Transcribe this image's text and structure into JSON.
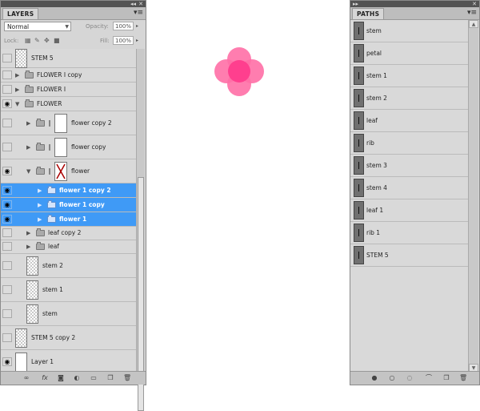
{
  "layers_panel": {
    "tab": "LAYERS",
    "blend_mode": "Normal",
    "opacity_label": "Opacity:",
    "opacity_value": "100%",
    "lock_label": "Lock:",
    "fill_label": "Fill:",
    "fill_value": "100%",
    "rows": [
      {
        "name": "STEM 5",
        "visible": false,
        "type": "pixel-checker",
        "indent": 0
      },
      {
        "name": "FLOWER I copy",
        "visible": false,
        "type": "group",
        "expanded": false,
        "indent": 0
      },
      {
        "name": "FLOWER I",
        "visible": false,
        "type": "group",
        "expanded": false,
        "indent": 0
      },
      {
        "name": "FLOWER",
        "visible": true,
        "type": "group",
        "expanded": true,
        "indent": 0
      },
      {
        "name": "flower copy 2",
        "visible": false,
        "type": "group-masked",
        "expanded": false,
        "indent": 1
      },
      {
        "name": "flower copy",
        "visible": false,
        "type": "group-masked",
        "expanded": false,
        "indent": 1
      },
      {
        "name": "flower",
        "visible": true,
        "type": "group-masked-x",
        "expanded": true,
        "indent": 1
      },
      {
        "name": "flower 1 copy 2",
        "visible": true,
        "type": "group",
        "expanded": false,
        "indent": 2,
        "selected": true
      },
      {
        "name": "flower 1 copy",
        "visible": true,
        "type": "group",
        "expanded": false,
        "indent": 2,
        "selected": true
      },
      {
        "name": "flower 1",
        "visible": true,
        "type": "group",
        "expanded": false,
        "indent": 2,
        "selected": true
      },
      {
        "name": "leaf copy 2",
        "visible": false,
        "type": "group",
        "expanded": false,
        "indent": 1
      },
      {
        "name": "leaf",
        "visible": false,
        "type": "group",
        "expanded": false,
        "indent": 1
      },
      {
        "name": "stem 2",
        "visible": false,
        "type": "pixel-checker",
        "indent": 1
      },
      {
        "name": "stem 1",
        "visible": false,
        "type": "pixel-checker",
        "indent": 1
      },
      {
        "name": "stem",
        "visible": false,
        "type": "pixel-checker",
        "indent": 1
      },
      {
        "name": "STEM 5 copy 2",
        "visible": false,
        "type": "pixel-checker",
        "indent": 0
      },
      {
        "name": "Layer 1",
        "visible": true,
        "type": "pixel-white",
        "indent": 0
      }
    ],
    "footer_icons": [
      "link-icon",
      "fx-icon",
      "mask-icon",
      "adjustment-icon",
      "new-group-icon",
      "new-layer-icon",
      "trash-icon"
    ]
  },
  "paths_panel": {
    "tab": "PATHS",
    "rows": [
      "stem",
      "petal",
      "stem 1",
      "stem 2",
      "leaf",
      "rib",
      "stem 3",
      "stem 4",
      "leaf 1",
      "rib 1",
      "STEM 5"
    ],
    "footer_icons": [
      "fill-path-icon",
      "stroke-path-icon",
      "load-selection-icon",
      "make-path-icon",
      "new-path-icon",
      "trash-icon"
    ]
  },
  "colors": {
    "selection": "#3f9af6",
    "flower_pink": "#ff6fa6",
    "flower_magenta": "#ff3f8e"
  }
}
